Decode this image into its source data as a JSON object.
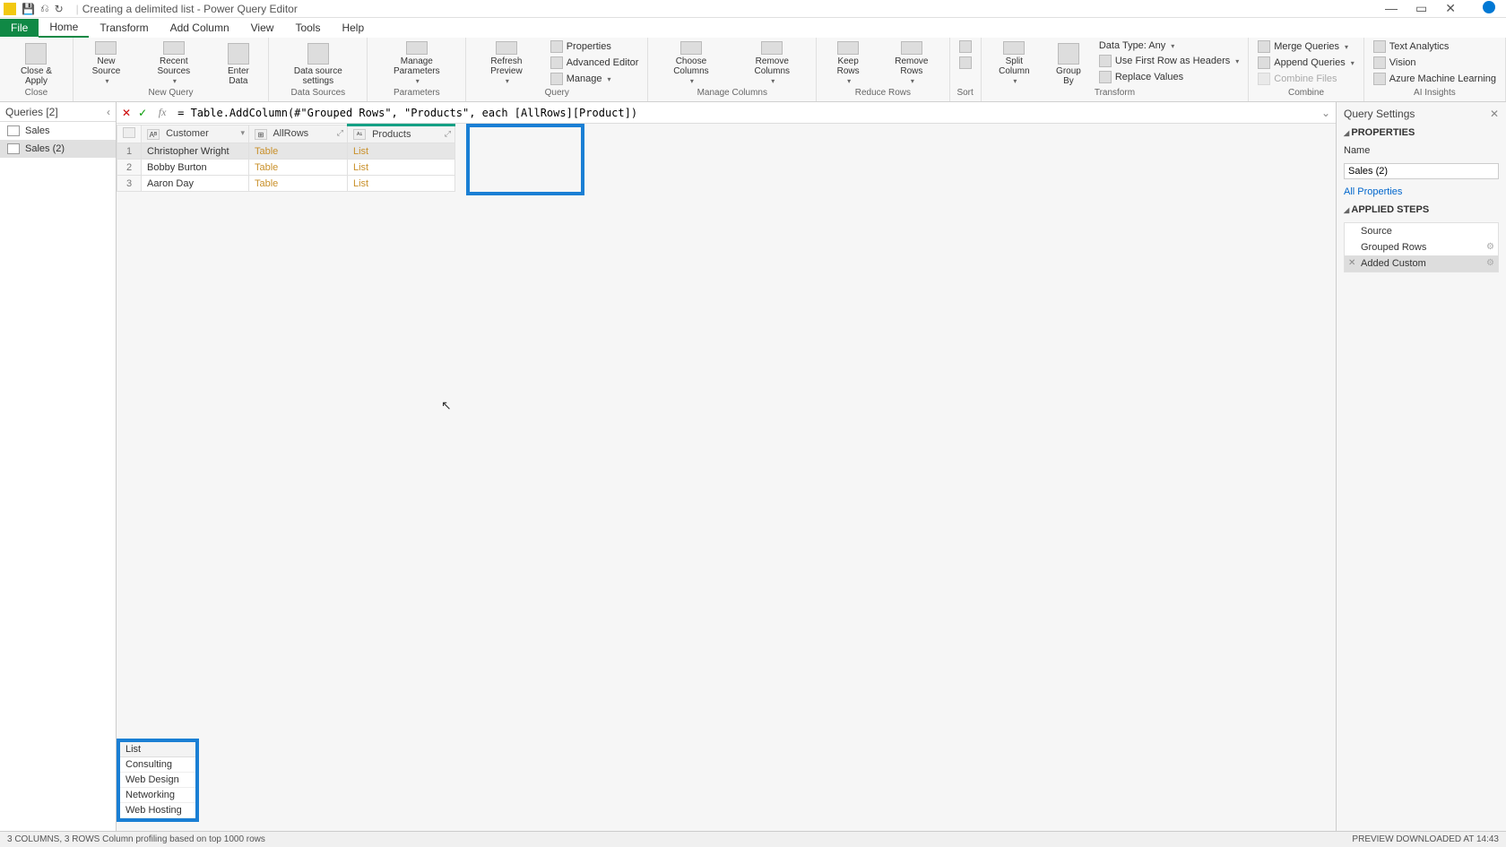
{
  "titlebar": {
    "title": "Creating a delimited list - Power Query Editor"
  },
  "tabs": [
    "File",
    "Home",
    "Transform",
    "Add Column",
    "View",
    "Tools",
    "Help"
  ],
  "ribbon": {
    "close": {
      "label": "Close &\nApply",
      "group": "Close"
    },
    "newquery": {
      "new_source": "New\nSource",
      "recent": "Recent\nSources",
      "enter": "Enter\nData",
      "group": "New Query"
    },
    "datasources": {
      "label": "Data source\nsettings",
      "group": "Data Sources"
    },
    "parameters": {
      "label": "Manage\nParameters",
      "group": "Parameters"
    },
    "query": {
      "refresh": "Refresh\nPreview",
      "properties": "Properties",
      "advanced": "Advanced Editor",
      "manage": "Manage",
      "group": "Query"
    },
    "managecols": {
      "choose": "Choose\nColumns",
      "remove": "Remove\nColumns",
      "group": "Manage Columns"
    },
    "reducerows": {
      "keep": "Keep\nRows",
      "removerows": "Remove\nRows",
      "group": "Reduce Rows"
    },
    "sort": {
      "group": "Sort"
    },
    "transform": {
      "split": "Split\nColumn",
      "groupby": "Group\nBy",
      "datatype": "Data Type: Any",
      "firstrow": "Use First Row as Headers",
      "replace": "Replace Values",
      "group": "Transform"
    },
    "combine": {
      "merge": "Merge Queries",
      "append": "Append Queries",
      "combinefiles": "Combine Files",
      "group": "Combine"
    },
    "ai": {
      "text": "Text Analytics",
      "vision": "Vision",
      "ml": "Azure Machine Learning",
      "group": "AI Insights"
    }
  },
  "queries": {
    "header": "Queries [2]",
    "items": [
      {
        "name": "Sales",
        "selected": false
      },
      {
        "name": "Sales (2)",
        "selected": true
      }
    ]
  },
  "formula": "= Table.AddColumn(#\"Grouped Rows\", \"Products\", each [AllRows][Product])",
  "grid": {
    "columns": [
      {
        "name": "Customer",
        "type": "ABC"
      },
      {
        "name": "AllRows",
        "type": "⊞"
      },
      {
        "name": "Products",
        "type": "ABC\n123",
        "highlighted": true
      }
    ],
    "rows": [
      {
        "num": 1,
        "customer": "Christopher Wright",
        "allrows": "Table",
        "products": "List",
        "selected": true
      },
      {
        "num": 2,
        "customer": "Bobby Burton",
        "allrows": "Table",
        "products": "List"
      },
      {
        "num": 3,
        "customer": "Aaron Day",
        "allrows": "Table",
        "products": "List"
      }
    ]
  },
  "preview_list": {
    "header": "List",
    "items": [
      "Consulting",
      "Web Design",
      "Networking",
      "Web Hosting"
    ]
  },
  "settings": {
    "title": "Query Settings",
    "properties_label": "PROPERTIES",
    "name_label": "Name",
    "name_value": "Sales (2)",
    "all_properties": "All Properties",
    "applied_steps_label": "APPLIED STEPS",
    "steps": [
      {
        "name": "Source",
        "selected": false,
        "gear": false
      },
      {
        "name": "Grouped Rows",
        "selected": false,
        "gear": true
      },
      {
        "name": "Added Custom",
        "selected": true,
        "gear": true,
        "del": true
      }
    ]
  },
  "statusbar": {
    "left": "3 COLUMNS, 3 ROWS    Column profiling based on top 1000 rows",
    "right": "PREVIEW DOWNLOADED AT 14:43"
  }
}
